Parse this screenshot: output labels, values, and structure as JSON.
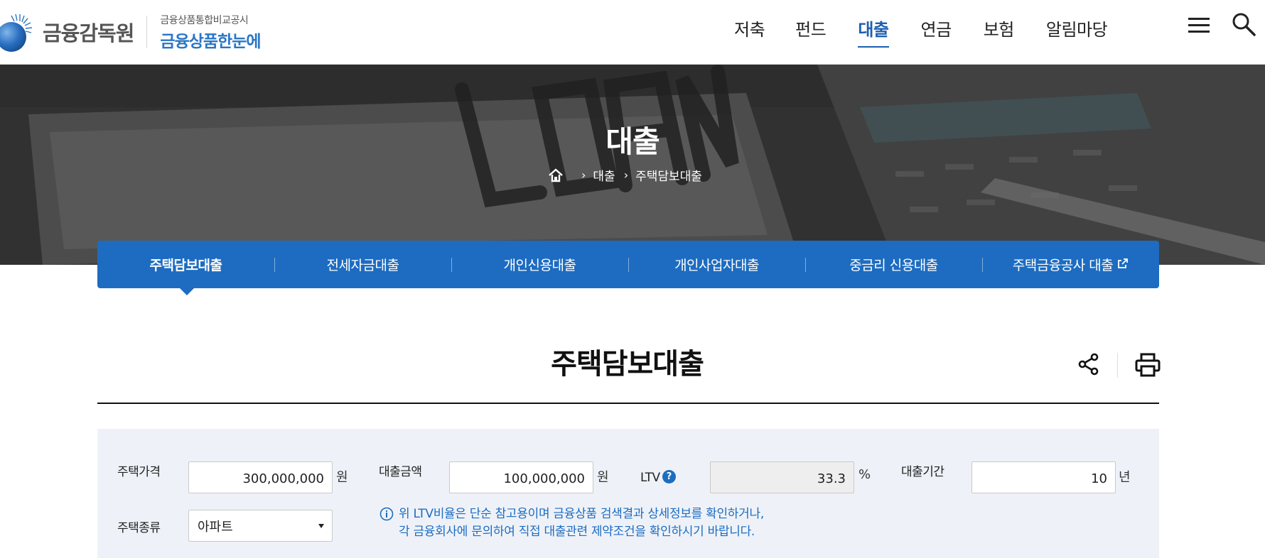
{
  "header": {
    "logo_text": "금융감독원",
    "logo_sub_top": "금융상품통합비교공시",
    "logo_sub_main": "금융상품한눈에",
    "nav": [
      {
        "label": "저축"
      },
      {
        "label": "펀드"
      },
      {
        "label": "대출",
        "active": true
      },
      {
        "label": "연금"
      },
      {
        "label": "보험"
      },
      {
        "label": "알림마당"
      }
    ],
    "menu_icon": "hamburger-icon",
    "search_icon": "search-icon"
  },
  "banner": {
    "title": "대출",
    "breadcrumb": [
      "대출",
      "주택담보대출"
    ],
    "home_icon": "home-icon"
  },
  "tabs": [
    {
      "label": "주택담보대출",
      "active": true
    },
    {
      "label": "전세자금대출"
    },
    {
      "label": "개인신용대출"
    },
    {
      "label": "개인사업자대출"
    },
    {
      "label": "중금리 신용대출"
    },
    {
      "label": "주택금융공사 대출",
      "external": true
    }
  ],
  "page": {
    "title": "주택담보대출",
    "share_icon": "share-icon",
    "print_icon": "print-icon"
  },
  "calculator": {
    "house_price_label": "주택가격",
    "house_price_value": "300,000,000",
    "house_price_unit": "원",
    "loan_amount_label": "대출금액",
    "loan_amount_value": "100,000,000",
    "loan_amount_unit": "원",
    "ltv_label": "LTV",
    "ltv_value": "33.3",
    "ltv_unit": "%",
    "loan_period_label": "대출기간",
    "loan_period_value": "10",
    "loan_period_unit": "년",
    "house_type_label": "주택종류",
    "house_type_value": "아파트",
    "notice_line1": "위 LTV비율은 단순 참고용이며 금융상품 검색결과 상세정보를 확인하거나,",
    "notice_line2": "각 금융회사에 문의하여 직접 대출관련 제약조건을 확인하시기 바랍니다."
  },
  "colors": {
    "brand_blue": "#1d6cc1",
    "nav_active": "#1d5fb1",
    "panel_bg": "#eef2f8"
  }
}
